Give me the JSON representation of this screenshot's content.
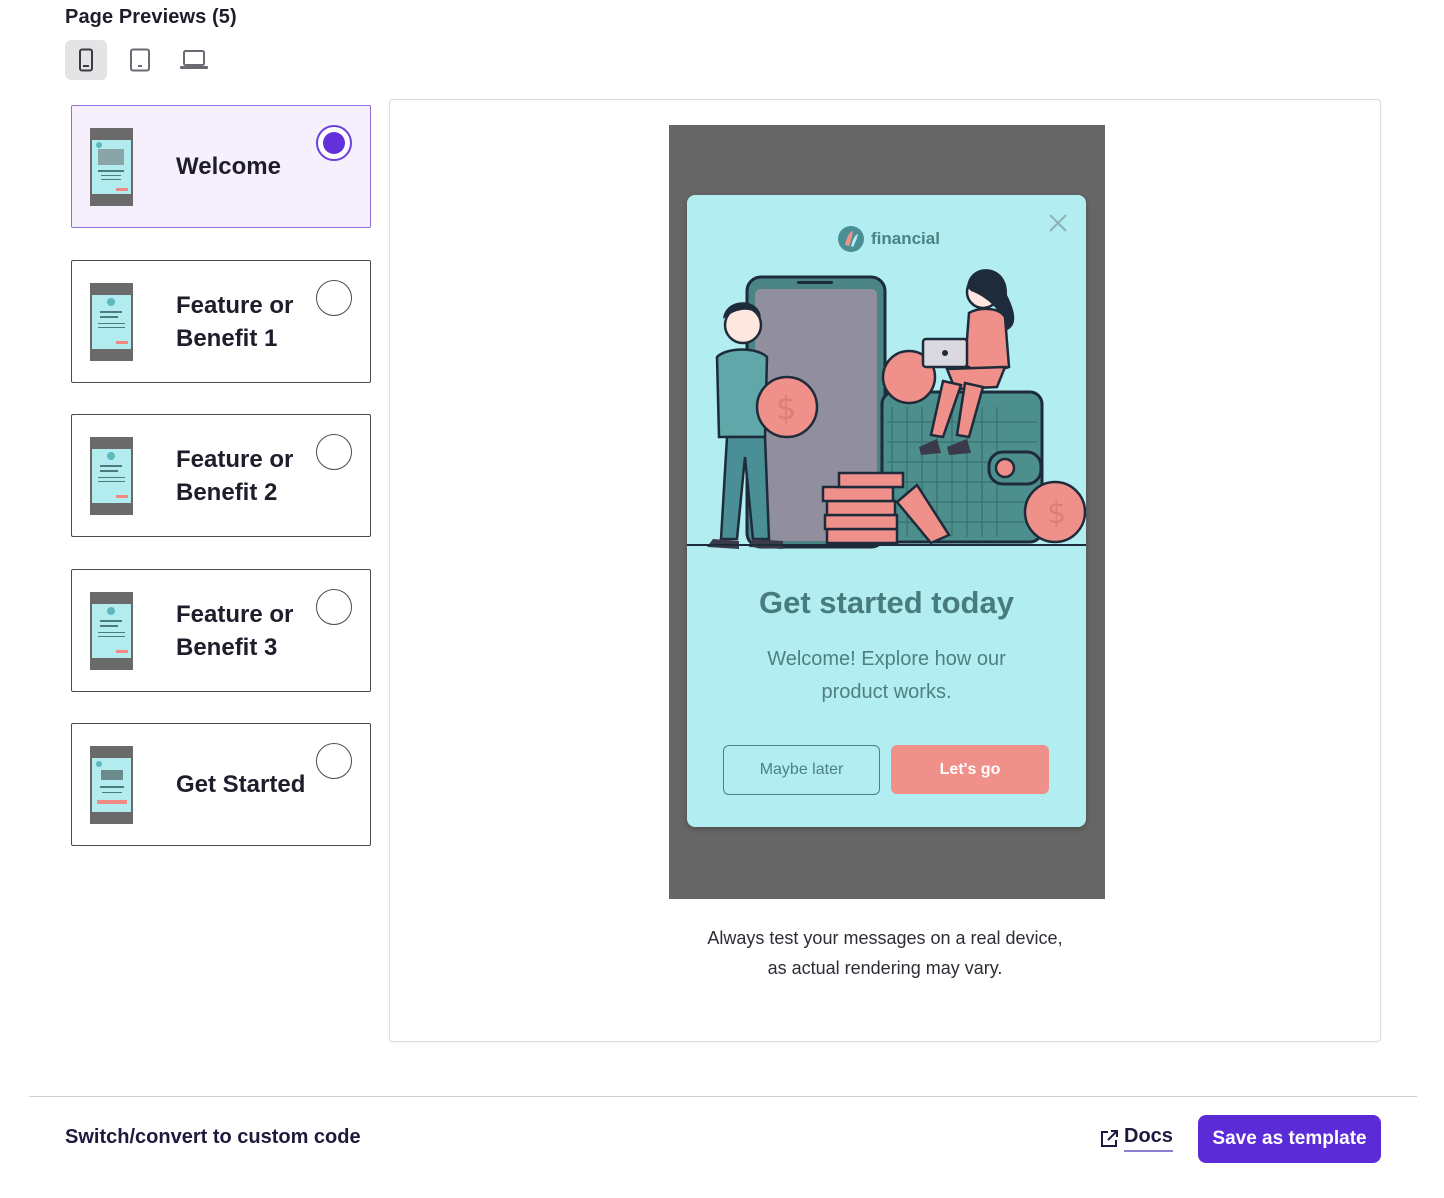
{
  "header": {
    "title": "Page Previews (5)"
  },
  "device_switcher": {
    "options": [
      {
        "name": "mobile-icon",
        "active": true
      },
      {
        "name": "tablet-icon",
        "active": false
      },
      {
        "name": "desktop-icon",
        "active": false
      }
    ]
  },
  "pages": [
    {
      "line1": "Welcome",
      "line2": "",
      "selected": true
    },
    {
      "line1": "Feature or",
      "line2": "Benefit 1",
      "selected": false
    },
    {
      "line1": "Feature or",
      "line2": "Benefit 2",
      "selected": false
    },
    {
      "line1": "Feature or",
      "line2": "Benefit 3",
      "selected": false
    },
    {
      "line1": "Get Started",
      "line2": "",
      "selected": false
    }
  ],
  "preview": {
    "brand_name": "financial",
    "title": "Get started today",
    "body": "Welcome! Explore how our product works.",
    "secondary_button": "Maybe later",
    "primary_button": "Let's go",
    "notice_line1": "Always test your messages on a real device,",
    "notice_line2": "as actual rendering may vary."
  },
  "footer": {
    "custom_code_link": "Switch/convert to custom code",
    "docs_link": "Docs",
    "save_button": "Save as template"
  },
  "colors": {
    "accent": "#5b2bd8",
    "modal_bg": "#b2eef1",
    "primary_cta": "#f0908a",
    "teal_text": "#477b7c"
  }
}
